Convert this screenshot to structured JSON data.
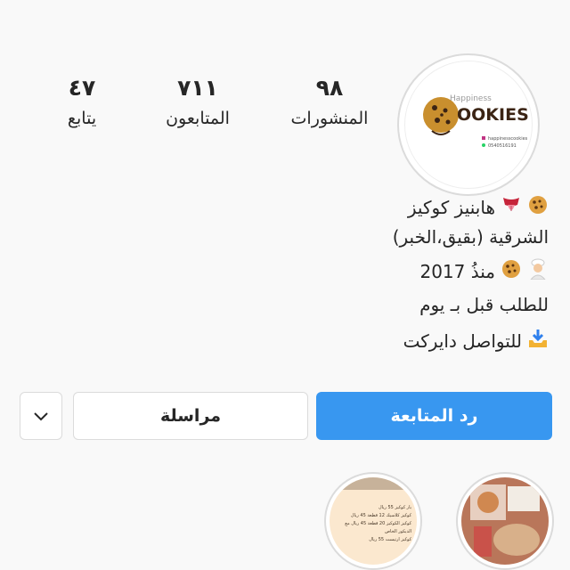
{
  "profile": {
    "logo": {
      "brand_word": "OOKIES",
      "brand_letter": "C",
      "brand_small": "Happiness",
      "handle": "happinesscookies",
      "phone": "0540516191"
    },
    "stats": [
      {
        "key": "posts",
        "value": "٩٨",
        "label": "المنشورات"
      },
      {
        "key": "followers",
        "value": "٧١١",
        "label": "المتابعون"
      },
      {
        "key": "following",
        "value": "٤٧",
        "label": "يتابع"
      }
    ],
    "bio": {
      "name": "هابنيز كوكيز",
      "location": "الشرقية (بقيق،الخبر)",
      "since": "منذُ 2017",
      "order_note": "للطلب قبل بـ يوم",
      "contact": "للتواصل دايركت"
    }
  },
  "actions": {
    "follow_back_label": "رد المتابعة",
    "message_label": "مراسلة",
    "dropdown_icon": "chevron-down-icon"
  },
  "highlights": [
    {
      "name": "highlight-photo-cookies"
    },
    {
      "name": "highlight-menu",
      "lines": [
        "بار كوكيز 55 ريال",
        "كوكيز كلاسيك 12 قطعة 45 ريال",
        "كوكيز الكوكيز 20 قطعة 45 ريال مع الديكور الخاص",
        "كوكيز ارتيست 55 ريال"
      ]
    }
  ],
  "colors": {
    "primary_button": "#3897f0",
    "background": "#f9f9f9",
    "border": "#dbdbdb",
    "text": "#262626"
  }
}
